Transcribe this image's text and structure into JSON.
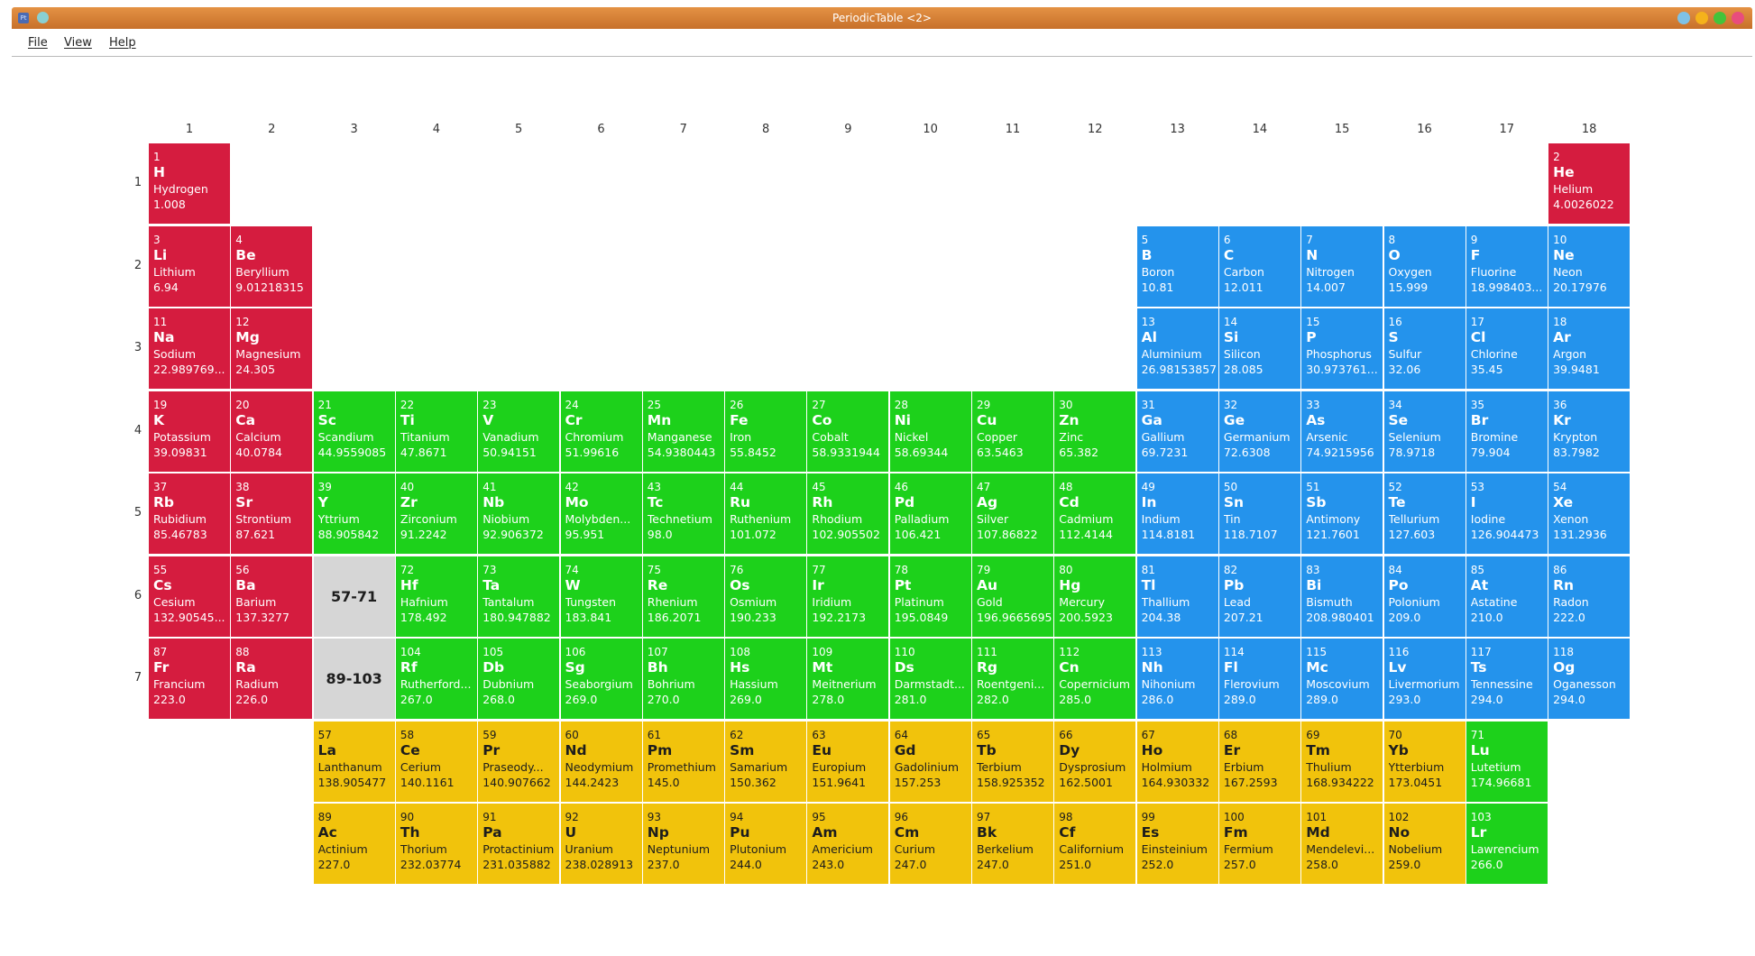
{
  "window": {
    "title": "PeriodicTable <2>",
    "app_icon": "Pt",
    "buttons": [
      {
        "name": "minimize-button",
        "color": "#7fc2e6"
      },
      {
        "name": "maximize-button",
        "color": "#f5b21b"
      },
      {
        "name": "restore-button",
        "color": "#43c43a"
      },
      {
        "name": "close-button",
        "color": "#e84d7d"
      }
    ]
  },
  "menu": [
    "File",
    "View",
    "Help"
  ],
  "colors": {
    "alkali_red": "#d51c3f",
    "transition_green": "#1dd11b",
    "pblock_blue": "#2493ec",
    "lanthanide_yellow": "#f1c30c",
    "placeholder_gray": "#d6d6d6"
  },
  "group_labels": [
    "1",
    "2",
    "3",
    "4",
    "5",
    "6",
    "7",
    "8",
    "9",
    "10",
    "11",
    "12",
    "13",
    "14",
    "15",
    "16",
    "17",
    "18"
  ],
  "period_labels": [
    "1",
    "2",
    "3",
    "4",
    "5",
    "6",
    "7"
  ],
  "placeholders": [
    {
      "row": 6,
      "col": 3,
      "label": "57-71"
    },
    {
      "row": 7,
      "col": 3,
      "label": "89-103"
    }
  ],
  "elements": [
    {
      "n": "1",
      "sym": "H",
      "name": "Hydrogen",
      "mass": "1.008",
      "row": 1,
      "col": 1,
      "cat": "r"
    },
    {
      "n": "2",
      "sym": "He",
      "name": "Helium",
      "mass": "4.0026022",
      "row": 1,
      "col": 18,
      "cat": "r"
    },
    {
      "n": "3",
      "sym": "Li",
      "name": "Lithium",
      "mass": "6.94",
      "row": 2,
      "col": 1,
      "cat": "r"
    },
    {
      "n": "4",
      "sym": "Be",
      "name": "Beryllium",
      "mass": "9.01218315",
      "row": 2,
      "col": 2,
      "cat": "r"
    },
    {
      "n": "5",
      "sym": "B",
      "name": "Boron",
      "mass": "10.81",
      "row": 2,
      "col": 13,
      "cat": "b"
    },
    {
      "n": "6",
      "sym": "C",
      "name": "Carbon",
      "mass": "12.011",
      "row": 2,
      "col": 14,
      "cat": "b"
    },
    {
      "n": "7",
      "sym": "N",
      "name": "Nitrogen",
      "mass": "14.007",
      "row": 2,
      "col": 15,
      "cat": "b"
    },
    {
      "n": "8",
      "sym": "O",
      "name": "Oxygen",
      "mass": "15.999",
      "row": 2,
      "col": 16,
      "cat": "b"
    },
    {
      "n": "9",
      "sym": "F",
      "name": "Fluorine",
      "mass": "18.998403...",
      "row": 2,
      "col": 17,
      "cat": "b"
    },
    {
      "n": "10",
      "sym": "Ne",
      "name": "Neon",
      "mass": "20.17976",
      "row": 2,
      "col": 18,
      "cat": "b"
    },
    {
      "n": "11",
      "sym": "Na",
      "name": "Sodium",
      "mass": "22.989769...",
      "row": 3,
      "col": 1,
      "cat": "r"
    },
    {
      "n": "12",
      "sym": "Mg",
      "name": "Magnesium",
      "mass": "24.305",
      "row": 3,
      "col": 2,
      "cat": "r"
    },
    {
      "n": "13",
      "sym": "Al",
      "name": "Aluminium",
      "mass": "26.98153857",
      "row": 3,
      "col": 13,
      "cat": "b"
    },
    {
      "n": "14",
      "sym": "Si",
      "name": "Silicon",
      "mass": "28.085",
      "row": 3,
      "col": 14,
      "cat": "b"
    },
    {
      "n": "15",
      "sym": "P",
      "name": "Phosphorus",
      "mass": "30.973761...",
      "row": 3,
      "col": 15,
      "cat": "b"
    },
    {
      "n": "16",
      "sym": "S",
      "name": "Sulfur",
      "mass": "32.06",
      "row": 3,
      "col": 16,
      "cat": "b"
    },
    {
      "n": "17",
      "sym": "Cl",
      "name": "Chlorine",
      "mass": "35.45",
      "row": 3,
      "col": 17,
      "cat": "b"
    },
    {
      "n": "18",
      "sym": "Ar",
      "name": "Argon",
      "mass": "39.9481",
      "row": 3,
      "col": 18,
      "cat": "b"
    },
    {
      "n": "19",
      "sym": "K",
      "name": "Potassium",
      "mass": "39.09831",
      "row": 4,
      "col": 1,
      "cat": "r"
    },
    {
      "n": "20",
      "sym": "Ca",
      "name": "Calcium",
      "mass": "40.0784",
      "row": 4,
      "col": 2,
      "cat": "r"
    },
    {
      "n": "21",
      "sym": "Sc",
      "name": "Scandium",
      "mass": "44.9559085",
      "row": 4,
      "col": 3,
      "cat": "g"
    },
    {
      "n": "22",
      "sym": "Ti",
      "name": "Titanium",
      "mass": "47.8671",
      "row": 4,
      "col": 4,
      "cat": "g"
    },
    {
      "n": "23",
      "sym": "V",
      "name": "Vanadium",
      "mass": "50.94151",
      "row": 4,
      "col": 5,
      "cat": "g"
    },
    {
      "n": "24",
      "sym": "Cr",
      "name": "Chromium",
      "mass": "51.99616",
      "row": 4,
      "col": 6,
      "cat": "g"
    },
    {
      "n": "25",
      "sym": "Mn",
      "name": "Manganese",
      "mass": "54.9380443",
      "row": 4,
      "col": 7,
      "cat": "g"
    },
    {
      "n": "26",
      "sym": "Fe",
      "name": "Iron",
      "mass": "55.8452",
      "row": 4,
      "col": 8,
      "cat": "g"
    },
    {
      "n": "27",
      "sym": "Co",
      "name": "Cobalt",
      "mass": "58.9331944",
      "row": 4,
      "col": 9,
      "cat": "g"
    },
    {
      "n": "28",
      "sym": "Ni",
      "name": "Nickel",
      "mass": "58.69344",
      "row": 4,
      "col": 10,
      "cat": "g"
    },
    {
      "n": "29",
      "sym": "Cu",
      "name": "Copper",
      "mass": "63.5463",
      "row": 4,
      "col": 11,
      "cat": "g"
    },
    {
      "n": "30",
      "sym": "Zn",
      "name": "Zinc",
      "mass": "65.382",
      "row": 4,
      "col": 12,
      "cat": "g"
    },
    {
      "n": "31",
      "sym": "Ga",
      "name": "Gallium",
      "mass": "69.7231",
      "row": 4,
      "col": 13,
      "cat": "b"
    },
    {
      "n": "32",
      "sym": "Ge",
      "name": "Germanium",
      "mass": "72.6308",
      "row": 4,
      "col": 14,
      "cat": "b"
    },
    {
      "n": "33",
      "sym": "As",
      "name": "Arsenic",
      "mass": "74.9215956",
      "row": 4,
      "col": 15,
      "cat": "b"
    },
    {
      "n": "34",
      "sym": "Se",
      "name": "Selenium",
      "mass": "78.9718",
      "row": 4,
      "col": 16,
      "cat": "b"
    },
    {
      "n": "35",
      "sym": "Br",
      "name": "Bromine",
      "mass": "79.904",
      "row": 4,
      "col": 17,
      "cat": "b"
    },
    {
      "n": "36",
      "sym": "Kr",
      "name": "Krypton",
      "mass": "83.7982",
      "row": 4,
      "col": 18,
      "cat": "b"
    },
    {
      "n": "37",
      "sym": "Rb",
      "name": "Rubidium",
      "mass": "85.46783",
      "row": 5,
      "col": 1,
      "cat": "r"
    },
    {
      "n": "38",
      "sym": "Sr",
      "name": "Strontium",
      "mass": "87.621",
      "row": 5,
      "col": 2,
      "cat": "r"
    },
    {
      "n": "39",
      "sym": "Y",
      "name": "Yttrium",
      "mass": "88.905842",
      "row": 5,
      "col": 3,
      "cat": "g"
    },
    {
      "n": "40",
      "sym": "Zr",
      "name": "Zirconium",
      "mass": "91.2242",
      "row": 5,
      "col": 4,
      "cat": "g"
    },
    {
      "n": "41",
      "sym": "Nb",
      "name": "Niobium",
      "mass": "92.906372",
      "row": 5,
      "col": 5,
      "cat": "g"
    },
    {
      "n": "42",
      "sym": "Mo",
      "name": "Molybden...",
      "mass": "95.951",
      "row": 5,
      "col": 6,
      "cat": "g"
    },
    {
      "n": "43",
      "sym": "Tc",
      "name": "Technetium",
      "mass": "98.0",
      "row": 5,
      "col": 7,
      "cat": "g"
    },
    {
      "n": "44",
      "sym": "Ru",
      "name": "Ruthenium",
      "mass": "101.072",
      "row": 5,
      "col": 8,
      "cat": "g"
    },
    {
      "n": "45",
      "sym": "Rh",
      "name": "Rhodium",
      "mass": "102.905502",
      "row": 5,
      "col": 9,
      "cat": "g"
    },
    {
      "n": "46",
      "sym": "Pd",
      "name": "Palladium",
      "mass": "106.421",
      "row": 5,
      "col": 10,
      "cat": "g"
    },
    {
      "n": "47",
      "sym": "Ag",
      "name": "Silver",
      "mass": "107.86822",
      "row": 5,
      "col": 11,
      "cat": "g"
    },
    {
      "n": "48",
      "sym": "Cd",
      "name": "Cadmium",
      "mass": "112.4144",
      "row": 5,
      "col": 12,
      "cat": "g"
    },
    {
      "n": "49",
      "sym": "In",
      "name": "Indium",
      "mass": "114.8181",
      "row": 5,
      "col": 13,
      "cat": "b"
    },
    {
      "n": "50",
      "sym": "Sn",
      "name": "Tin",
      "mass": "118.7107",
      "row": 5,
      "col": 14,
      "cat": "b"
    },
    {
      "n": "51",
      "sym": "Sb",
      "name": "Antimony",
      "mass": "121.7601",
      "row": 5,
      "col": 15,
      "cat": "b"
    },
    {
      "n": "52",
      "sym": "Te",
      "name": "Tellurium",
      "mass": "127.603",
      "row": 5,
      "col": 16,
      "cat": "b"
    },
    {
      "n": "53",
      "sym": "I",
      "name": "Iodine",
      "mass": "126.904473",
      "row": 5,
      "col": 17,
      "cat": "b"
    },
    {
      "n": "54",
      "sym": "Xe",
      "name": "Xenon",
      "mass": "131.2936",
      "row": 5,
      "col": 18,
      "cat": "b"
    },
    {
      "n": "55",
      "sym": "Cs",
      "name": "Cesium",
      "mass": "132.90545...",
      "row": 6,
      "col": 1,
      "cat": "r"
    },
    {
      "n": "56",
      "sym": "Ba",
      "name": "Barium",
      "mass": "137.3277",
      "row": 6,
      "col": 2,
      "cat": "r"
    },
    {
      "n": "72",
      "sym": "Hf",
      "name": "Hafnium",
      "mass": "178.492",
      "row": 6,
      "col": 4,
      "cat": "g"
    },
    {
      "n": "73",
      "sym": "Ta",
      "name": "Tantalum",
      "mass": "180.947882",
      "row": 6,
      "col": 5,
      "cat": "g"
    },
    {
      "n": "74",
      "sym": "W",
      "name": "Tungsten",
      "mass": "183.841",
      "row": 6,
      "col": 6,
      "cat": "g"
    },
    {
      "n": "75",
      "sym": "Re",
      "name": "Rhenium",
      "mass": "186.2071",
      "row": 6,
      "col": 7,
      "cat": "g"
    },
    {
      "n": "76",
      "sym": "Os",
      "name": "Osmium",
      "mass": "190.233",
      "row": 6,
      "col": 8,
      "cat": "g"
    },
    {
      "n": "77",
      "sym": "Ir",
      "name": "Iridium",
      "mass": "192.2173",
      "row": 6,
      "col": 9,
      "cat": "g"
    },
    {
      "n": "78",
      "sym": "Pt",
      "name": "Platinum",
      "mass": "195.0849",
      "row": 6,
      "col": 10,
      "cat": "g"
    },
    {
      "n": "79",
      "sym": "Au",
      "name": "Gold",
      "mass": "196.9665695",
      "row": 6,
      "col": 11,
      "cat": "g"
    },
    {
      "n": "80",
      "sym": "Hg",
      "name": "Mercury",
      "mass": "200.5923",
      "row": 6,
      "col": 12,
      "cat": "g"
    },
    {
      "n": "81",
      "sym": "Tl",
      "name": "Thallium",
      "mass": "204.38",
      "row": 6,
      "col": 13,
      "cat": "b"
    },
    {
      "n": "82",
      "sym": "Pb",
      "name": "Lead",
      "mass": "207.21",
      "row": 6,
      "col": 14,
      "cat": "b"
    },
    {
      "n": "83",
      "sym": "Bi",
      "name": "Bismuth",
      "mass": "208.980401",
      "row": 6,
      "col": 15,
      "cat": "b"
    },
    {
      "n": "84",
      "sym": "Po",
      "name": "Polonium",
      "mass": "209.0",
      "row": 6,
      "col": 16,
      "cat": "b"
    },
    {
      "n": "85",
      "sym": "At",
      "name": "Astatine",
      "mass": "210.0",
      "row": 6,
      "col": 17,
      "cat": "b"
    },
    {
      "n": "86",
      "sym": "Rn",
      "name": "Radon",
      "mass": "222.0",
      "row": 6,
      "col": 18,
      "cat": "b"
    },
    {
      "n": "87",
      "sym": "Fr",
      "name": "Francium",
      "mass": "223.0",
      "row": 7,
      "col": 1,
      "cat": "r"
    },
    {
      "n": "88",
      "sym": "Ra",
      "name": "Radium",
      "mass": "226.0",
      "row": 7,
      "col": 2,
      "cat": "r"
    },
    {
      "n": "104",
      "sym": "Rf",
      "name": "Rutherford...",
      "mass": "267.0",
      "row": 7,
      "col": 4,
      "cat": "g"
    },
    {
      "n": "105",
      "sym": "Db",
      "name": "Dubnium",
      "mass": "268.0",
      "row": 7,
      "col": 5,
      "cat": "g"
    },
    {
      "n": "106",
      "sym": "Sg",
      "name": "Seaborgium",
      "mass": "269.0",
      "row": 7,
      "col": 6,
      "cat": "g"
    },
    {
      "n": "107",
      "sym": "Bh",
      "name": "Bohrium",
      "mass": "270.0",
      "row": 7,
      "col": 7,
      "cat": "g"
    },
    {
      "n": "108",
      "sym": "Hs",
      "name": "Hassium",
      "mass": "269.0",
      "row": 7,
      "col": 8,
      "cat": "g"
    },
    {
      "n": "109",
      "sym": "Mt",
      "name": "Meitnerium",
      "mass": "278.0",
      "row": 7,
      "col": 9,
      "cat": "g"
    },
    {
      "n": "110",
      "sym": "Ds",
      "name": "Darmstadt...",
      "mass": "281.0",
      "row": 7,
      "col": 10,
      "cat": "g"
    },
    {
      "n": "111",
      "sym": "Rg",
      "name": "Roentgeni...",
      "mass": "282.0",
      "row": 7,
      "col": 11,
      "cat": "g"
    },
    {
      "n": "112",
      "sym": "Cn",
      "name": "Copernicium",
      "mass": "285.0",
      "row": 7,
      "col": 12,
      "cat": "g"
    },
    {
      "n": "113",
      "sym": "Nh",
      "name": "Nihonium",
      "mass": "286.0",
      "row": 7,
      "col": 13,
      "cat": "b"
    },
    {
      "n": "114",
      "sym": "Fl",
      "name": "Flerovium",
      "mass": "289.0",
      "row": 7,
      "col": 14,
      "cat": "b"
    },
    {
      "n": "115",
      "sym": "Mc",
      "name": "Moscovium",
      "mass": "289.0",
      "row": 7,
      "col": 15,
      "cat": "b"
    },
    {
      "n": "116",
      "sym": "Lv",
      "name": "Livermorium",
      "mass": "293.0",
      "row": 7,
      "col": 16,
      "cat": "b"
    },
    {
      "n": "117",
      "sym": "Ts",
      "name": "Tennessine",
      "mass": "294.0",
      "row": 7,
      "col": 17,
      "cat": "b"
    },
    {
      "n": "118",
      "sym": "Og",
      "name": "Oganesson",
      "mass": "294.0",
      "row": 7,
      "col": 18,
      "cat": "b"
    },
    {
      "n": "57",
      "sym": "La",
      "name": "Lanthanum",
      "mass": "138.905477",
      "row": 8,
      "col": 3,
      "cat": "y"
    },
    {
      "n": "58",
      "sym": "Ce",
      "name": "Cerium",
      "mass": "140.1161",
      "row": 8,
      "col": 4,
      "cat": "y"
    },
    {
      "n": "59",
      "sym": "Pr",
      "name": "Praseody...",
      "mass": "140.907662",
      "row": 8,
      "col": 5,
      "cat": "y"
    },
    {
      "n": "60",
      "sym": "Nd",
      "name": "Neodymium",
      "mass": "144.2423",
      "row": 8,
      "col": 6,
      "cat": "y"
    },
    {
      "n": "61",
      "sym": "Pm",
      "name": "Promethium",
      "mass": "145.0",
      "row": 8,
      "col": 7,
      "cat": "y"
    },
    {
      "n": "62",
      "sym": "Sm",
      "name": "Samarium",
      "mass": "150.362",
      "row": 8,
      "col": 8,
      "cat": "y"
    },
    {
      "n": "63",
      "sym": "Eu",
      "name": "Europium",
      "mass": "151.9641",
      "row": 8,
      "col": 9,
      "cat": "y"
    },
    {
      "n": "64",
      "sym": "Gd",
      "name": "Gadolinium",
      "mass": "157.253",
      "row": 8,
      "col": 10,
      "cat": "y"
    },
    {
      "n": "65",
      "sym": "Tb",
      "name": "Terbium",
      "mass": "158.925352",
      "row": 8,
      "col": 11,
      "cat": "y"
    },
    {
      "n": "66",
      "sym": "Dy",
      "name": "Dysprosium",
      "mass": "162.5001",
      "row": 8,
      "col": 12,
      "cat": "y"
    },
    {
      "n": "67",
      "sym": "Ho",
      "name": "Holmium",
      "mass": "164.930332",
      "row": 8,
      "col": 13,
      "cat": "y"
    },
    {
      "n": "68",
      "sym": "Er",
      "name": "Erbium",
      "mass": "167.2593",
      "row": 8,
      "col": 14,
      "cat": "y"
    },
    {
      "n": "69",
      "sym": "Tm",
      "name": "Thulium",
      "mass": "168.934222",
      "row": 8,
      "col": 15,
      "cat": "y"
    },
    {
      "n": "70",
      "sym": "Yb",
      "name": "Ytterbium",
      "mass": "173.0451",
      "row": 8,
      "col": 16,
      "cat": "y"
    },
    {
      "n": "71",
      "sym": "Lu",
      "name": "Lutetium",
      "mass": "174.96681",
      "row": 8,
      "col": 17,
      "cat": "g"
    },
    {
      "n": "89",
      "sym": "Ac",
      "name": "Actinium",
      "mass": "227.0",
      "row": 9,
      "col": 3,
      "cat": "y"
    },
    {
      "n": "90",
      "sym": "Th",
      "name": "Thorium",
      "mass": "232.03774",
      "row": 9,
      "col": 4,
      "cat": "y"
    },
    {
      "n": "91",
      "sym": "Pa",
      "name": "Protactinium",
      "mass": "231.035882",
      "row": 9,
      "col": 5,
      "cat": "y"
    },
    {
      "n": "92",
      "sym": "U",
      "name": "Uranium",
      "mass": "238.028913",
      "row": 9,
      "col": 6,
      "cat": "y"
    },
    {
      "n": "93",
      "sym": "Np",
      "name": "Neptunium",
      "mass": "237.0",
      "row": 9,
      "col": 7,
      "cat": "y"
    },
    {
      "n": "94",
      "sym": "Pu",
      "name": "Plutonium",
      "mass": "244.0",
      "row": 9,
      "col": 8,
      "cat": "y"
    },
    {
      "n": "95",
      "sym": "Am",
      "name": "Americium",
      "mass": "243.0",
      "row": 9,
      "col": 9,
      "cat": "y"
    },
    {
      "n": "96",
      "sym": "Cm",
      "name": "Curium",
      "mass": "247.0",
      "row": 9,
      "col": 10,
      "cat": "y"
    },
    {
      "n": "97",
      "sym": "Bk",
      "name": "Berkelium",
      "mass": "247.0",
      "row": 9,
      "col": 11,
      "cat": "y"
    },
    {
      "n": "98",
      "sym": "Cf",
      "name": "Californium",
      "mass": "251.0",
      "row": 9,
      "col": 12,
      "cat": "y"
    },
    {
      "n": "99",
      "sym": "Es",
      "name": "Einsteinium",
      "mass": "252.0",
      "row": 9,
      "col": 13,
      "cat": "y"
    },
    {
      "n": "100",
      "sym": "Fm",
      "name": "Fermium",
      "mass": "257.0",
      "row": 9,
      "col": 14,
      "cat": "y"
    },
    {
      "n": "101",
      "sym": "Md",
      "name": "Mendelevi...",
      "mass": "258.0",
      "row": 9,
      "col": 15,
      "cat": "y"
    },
    {
      "n": "102",
      "sym": "No",
      "name": "Nobelium",
      "mass": "259.0",
      "row": 9,
      "col": 16,
      "cat": "y"
    },
    {
      "n": "103",
      "sym": "Lr",
      "name": "Lawrencium",
      "mass": "266.0",
      "row": 9,
      "col": 17,
      "cat": "g"
    }
  ]
}
